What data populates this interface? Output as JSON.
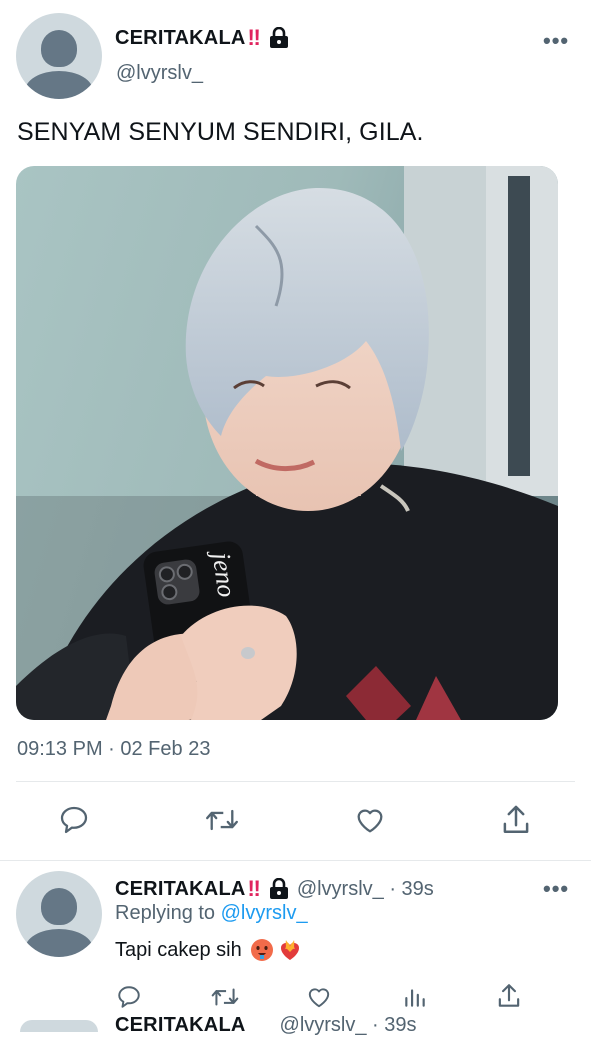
{
  "tweet": {
    "display_name": "CERITAKALA",
    "name_emoji": "‼",
    "handle": "@lvyrslv_",
    "more": "•••",
    "text": "SENYAM SENYUM SENDIRI, GILA.",
    "photo_caption": "jeno",
    "timestamp": "09:13 PM · 02 Feb 23"
  },
  "reply": {
    "display_name": "CERITAKALA",
    "name_emoji": "‼",
    "handle_time": "@lvyrslv_ · 39s",
    "replying_prefix": "Replying to",
    "replying_handle": "@lvyrslv_",
    "text": "Tapi cakep sih",
    "more": "•••"
  },
  "next_reply": {
    "display_name": "CERITAKALA",
    "handle_time": "@lvyrslv_ · 39s"
  },
  "colors": {
    "accent": "#1d9bf0",
    "text": "#0f1419",
    "secondary": "#536471",
    "divider": "#e6e9eb"
  },
  "icons": [
    "reply-icon",
    "retweet-icon",
    "like-icon",
    "share-icon",
    "views-icon",
    "lock-icon",
    "more-icon",
    "avatar-icon"
  ]
}
